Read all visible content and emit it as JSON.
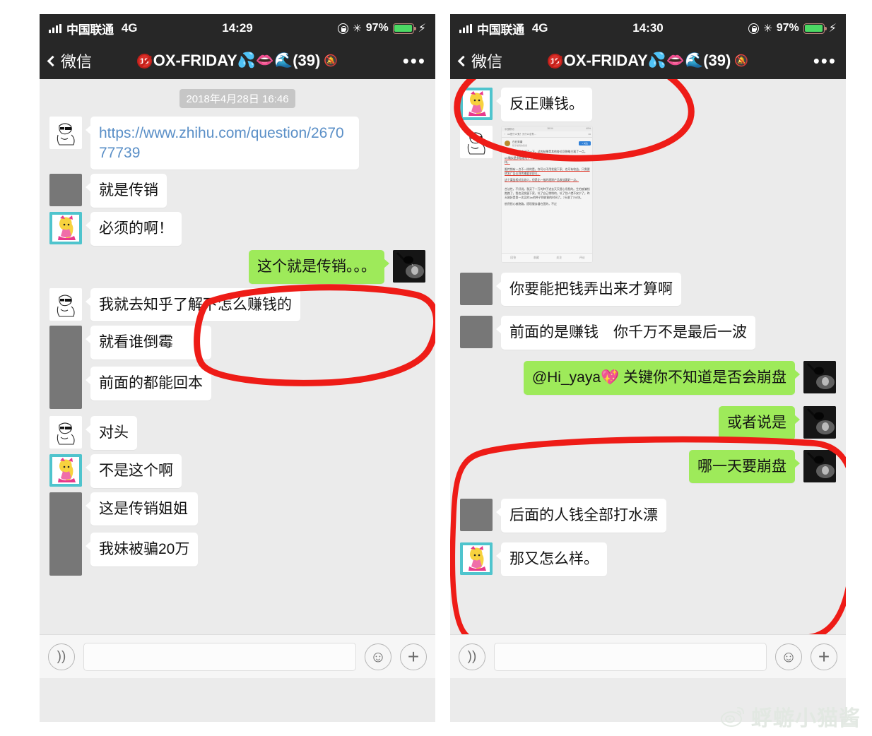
{
  "watermark": {
    "text": "蜉蝣小猫酱",
    "icon": "weibo-logo-icon"
  },
  "colors": {
    "green_bubble": "#9EEA5A",
    "white_bubble": "#FFFFFF",
    "annotation_red": "#EE1C17",
    "navbar": "#272727",
    "chat_background": "#EBEBEB",
    "link_blue": "#5A8FC7",
    "battery_green": "#4CD964"
  },
  "left": {
    "status": {
      "carrier": "中国联通",
      "network": "4G",
      "time": "14:29",
      "battery_percent": "97%",
      "icons": [
        "signal-bars-icon",
        "rotation-lock-icon",
        "bluetooth-icon",
        "battery-icon",
        "charging-bolt-icon"
      ]
    },
    "nav": {
      "back_label": "微信",
      "badge": "18",
      "title": "OX-FRIDAY",
      "title_emoji": [
        "💦",
        "👄",
        "🌊"
      ],
      "member_count": "(39)",
      "mute_icon": "muted-bell-icon",
      "more_icon": "more-dots-icon"
    },
    "datestamp": "2018年4月28日 16:46",
    "messages": [
      {
        "side": "other",
        "avatar": "sketch",
        "type": "link",
        "text": "https://www.zhihu.com/question/267077739"
      },
      {
        "side": "other",
        "avatar": "grey",
        "type": "text",
        "text": "就是传销"
      },
      {
        "side": "other",
        "avatar": "doll",
        "type": "text",
        "text": "必须的啊！"
      },
      {
        "side": "me",
        "avatar": "lamp",
        "type": "text",
        "text": "这个就是传销。。。",
        "highlighted": true
      },
      {
        "side": "other",
        "avatar": "sketch",
        "type": "text",
        "text": "我就去知乎了解下怎么赚钱的"
      },
      {
        "side": "other",
        "avatar": "grey",
        "type": "text",
        "text": "就看谁倒霉"
      },
      {
        "side": "other",
        "avatar": "none",
        "type": "text",
        "text": "前面的都能回本"
      },
      {
        "side": "other",
        "avatar": "sketch",
        "type": "text",
        "text": "对头"
      },
      {
        "side": "other",
        "avatar": "doll",
        "type": "text",
        "text": "不是这个啊"
      },
      {
        "side": "other",
        "avatar": "grey",
        "type": "text",
        "text": "这是传销姐姐"
      },
      {
        "side": "other",
        "avatar": "none",
        "type": "text",
        "text": "我妹被骗20万"
      }
    ],
    "input": {
      "voice_icon": "voice-wave-icon",
      "field_value": "",
      "field_placeholder": "",
      "emoji_icon": "smiley-face-icon",
      "plus_icon": "plus-icon"
    }
  },
  "right": {
    "status": {
      "carrier": "中国联通",
      "network": "4G",
      "time": "14:30",
      "battery_percent": "97%",
      "icons": [
        "signal-bars-icon",
        "rotation-lock-icon",
        "bluetooth-icon",
        "battery-icon",
        "charging-bolt-icon"
      ]
    },
    "nav": {
      "back_label": "微信",
      "badge": "18",
      "title": "OX-FRIDAY",
      "title_emoji": [
        "💦",
        "👄",
        "🌊"
      ],
      "member_count": "(39)",
      "mute_icon": "muted-bell-icon",
      "more_icon": "more-dots-icon"
    },
    "messages": [
      {
        "side": "other",
        "avatar": "doll",
        "type": "text",
        "text": "反正赚钱。",
        "highlighted": true
      },
      {
        "side": "other",
        "avatar": "sketch",
        "type": "image",
        "text": ""
      },
      {
        "side": "other",
        "avatar": "grey",
        "type": "text",
        "text": "你要能把钱弄出来才算啊"
      },
      {
        "side": "other",
        "avatar": "grey",
        "type": "text",
        "text": "前面的是赚钱　你千万不是最后一波"
      },
      {
        "side": "me",
        "avatar": "lamp",
        "type": "text",
        "text": "@Hi_yaya💖 关键你不知道是否会崩盘"
      },
      {
        "side": "me",
        "avatar": "lamp",
        "type": "text",
        "text": "或者说是",
        "highlighted": true
      },
      {
        "side": "me",
        "avatar": "lamp",
        "type": "text",
        "text": "哪一天要崩盘",
        "highlighted": true
      },
      {
        "side": "other",
        "avatar": "grey",
        "type": "text",
        "text": "后面的人钱全部打水漂",
        "highlighted": true
      },
      {
        "side": "other",
        "avatar": "doll",
        "type": "text",
        "text": "那又怎么样。",
        "highlighted": true
      }
    ],
    "embedded_screenshot": {
      "status_carrier": "中国联动",
      "status_time": "18:04",
      "status_battery": "40%",
      "nav_title": "uu是什么鬼？为什么总有…",
      "author": "白石秀康",
      "author_sub": "知乎编辑的答案",
      "follow_button": "+ 关注",
      "paragraphs": [
        {
          "text": "我是的真的进去试了一下。试的结果是其他各位回答略主观了一点。",
          "underlined": false
        },
        {
          "text": "uC确实是多级理给，下家越多拿到的买金种子越多，这一点跟传销一样。",
          "underlined": true
        },
        {
          "text": "跟传销有一点不一样的是，你可以不用发展下家，也可有收益。只需要转发广告达到传播要求即可。",
          "underlined": true
        },
        {
          "text": "这个渠益相对比较少，但是比一般的理财产品收益要好一点。",
          "underlined": true
        },
        {
          "text": "合法性，不好说。我买了一万的种子进去天天提心吊胆的。生怕被骗钱跑路了。我也没发展下家，坑了自己悄悄的，坑了别人就不安宁了。昨天刚好是第一次买的1w的种子到收割的时间了。7天收了700块。",
          "underlined": false
        },
        {
          "text": "依然担心被跑路。提现服务器在国外。不过",
          "underlined": false
        }
      ],
      "tabs": [
        "回答",
        "收藏",
        "关注",
        "评论"
      ]
    },
    "input": {
      "voice_icon": "voice-wave-icon",
      "field_value": "",
      "field_placeholder": "",
      "emoji_icon": "smiley-face-icon",
      "plus_icon": "plus-icon"
    }
  }
}
